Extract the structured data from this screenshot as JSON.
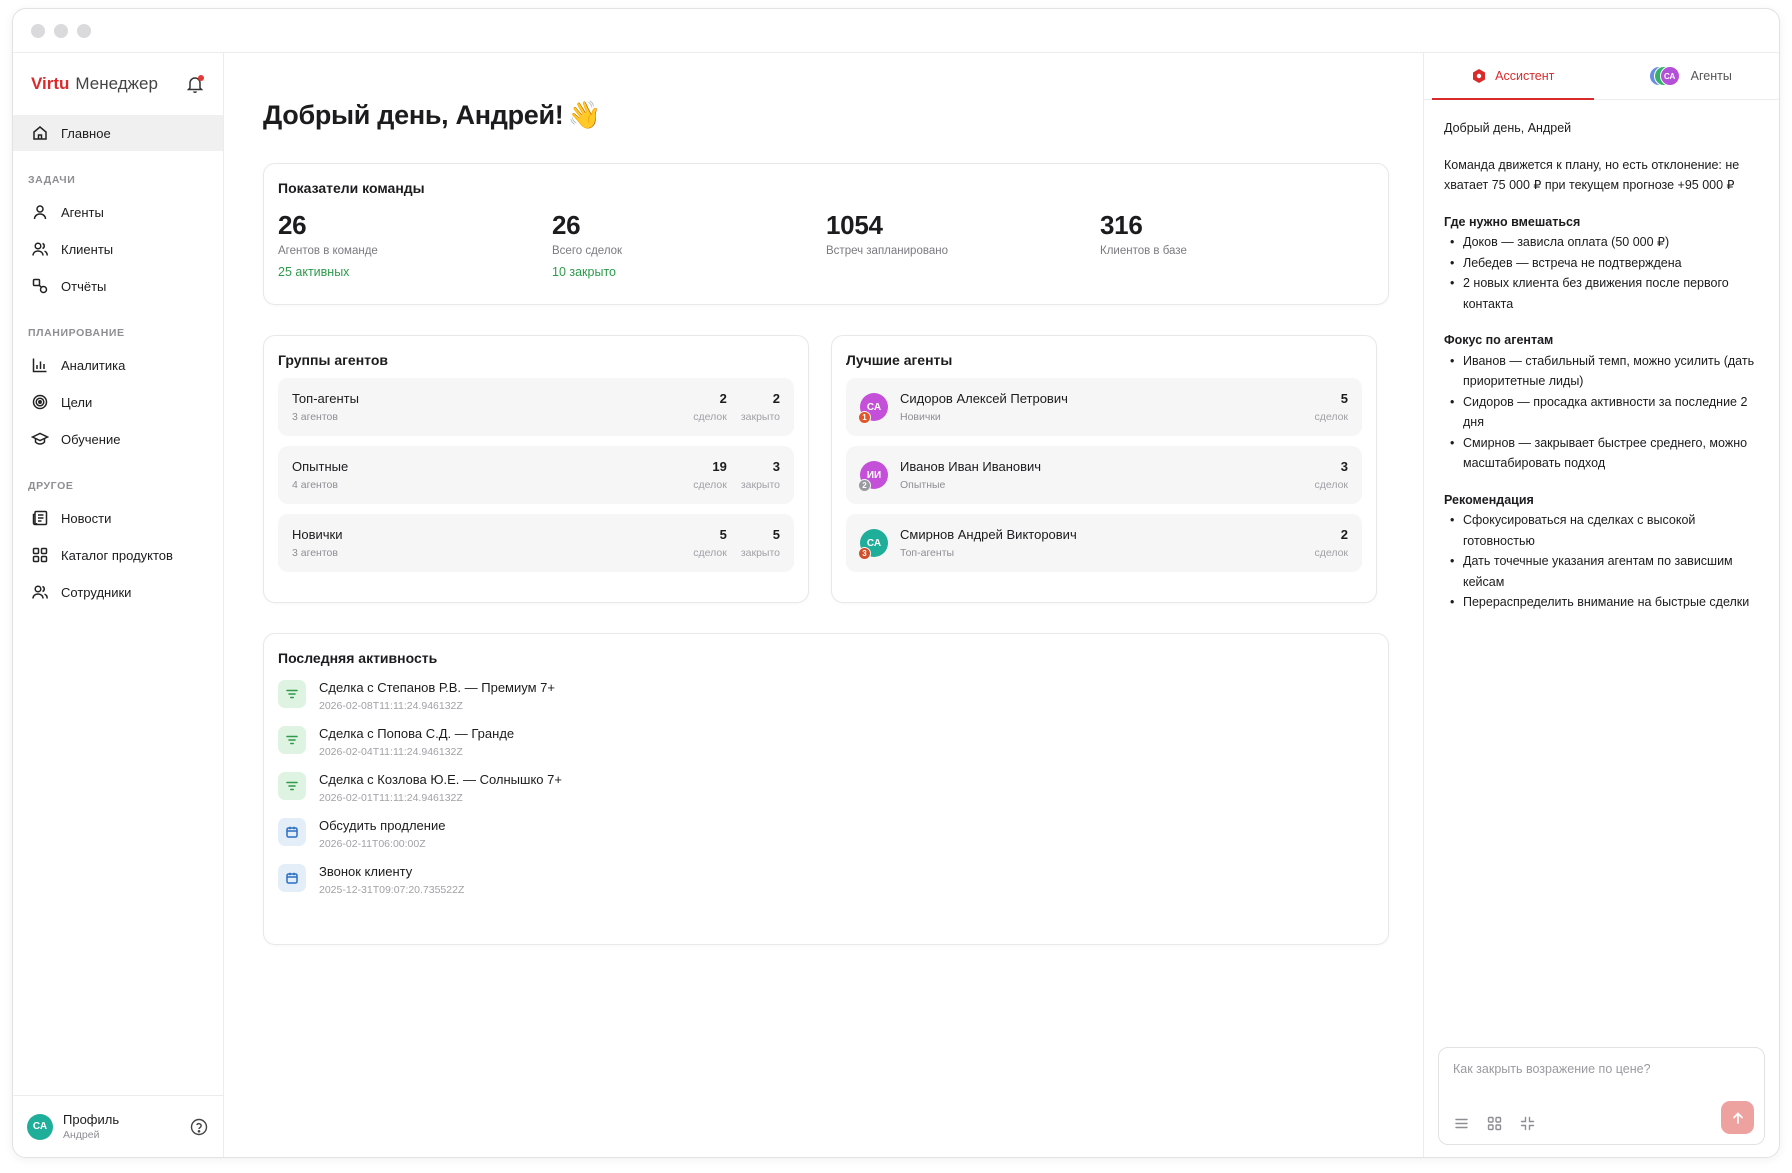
{
  "brand": {
    "virtu": "Virtu",
    "name": "Менеджер"
  },
  "nav": {
    "home": "Главное",
    "sections": {
      "tasks": "ЗАДАЧИ",
      "planning": "ПЛАНИРОВАНИЕ",
      "other": "ДРУГОЕ"
    },
    "items": {
      "agents": "Агенты",
      "clients": "Клиенты",
      "reports": "Отчёты",
      "analytics": "Аналитика",
      "goals": "Цели",
      "training": "Обучение",
      "news": "Новости",
      "catalog": "Каталог продуктов",
      "employees": "Сотрудники"
    }
  },
  "profile": {
    "initials": "СА",
    "name": "Профиль",
    "sub": "Андрей"
  },
  "greeting": "Добрый день, Андрей!",
  "greeting_emoji": "👋",
  "metrics": {
    "title": "Показатели команды",
    "items": [
      {
        "value": "26",
        "label": "Агентов в команде",
        "sub": "25 активных"
      },
      {
        "value": "26",
        "label": "Всего сделок",
        "sub": "10 закрыто"
      },
      {
        "value": "1054",
        "label": "Встреч запланировано",
        "sub": ""
      },
      {
        "value": "316",
        "label": "Клиентов в базе",
        "sub": ""
      }
    ]
  },
  "groups": {
    "title": "Группы агентов",
    "deals_label": "сделок",
    "closed_label": "закрыто",
    "items": [
      {
        "name": "Топ-агенты",
        "sub": "3 агентов",
        "deals": "2",
        "closed": "2"
      },
      {
        "name": "Опытные",
        "sub": "4 агентов",
        "deals": "19",
        "closed": "3"
      },
      {
        "name": "Новички",
        "sub": "3 агентов",
        "deals": "5",
        "closed": "5"
      }
    ]
  },
  "best_agents": {
    "title": "Лучшие агенты",
    "deals_label": "сделок",
    "items": [
      {
        "initials": "СА",
        "rank": "1",
        "name": "Сидоров Алексей Петрович",
        "group": "Новички",
        "deals": "5",
        "color": "#c44fd8",
        "rank_color": "#e0582a"
      },
      {
        "initials": "ИИ",
        "rank": "2",
        "name": "Иванов Иван Иванович",
        "group": "Опытные",
        "deals": "3",
        "color": "#c44fd8",
        "rank_color": "#9a9aa0"
      },
      {
        "initials": "СА",
        "rank": "3",
        "name": "Смирнов Андрей Викторович",
        "group": "Топ-агенты",
        "deals": "2",
        "color": "#1fae9a",
        "rank_color": "#d0502a"
      }
    ]
  },
  "activity": {
    "title": "Последняя активность",
    "items": [
      {
        "type": "deal",
        "icon": "filter-icon",
        "title": "Сделка с Степанов Р.В. — Премиум 7+",
        "date": "2026-02-08T11:11:24.946132Z"
      },
      {
        "type": "deal",
        "icon": "filter-icon",
        "title": "Сделка с Попова С.Д. — Гранде",
        "date": "2026-02-04T11:11:24.946132Z"
      },
      {
        "type": "deal",
        "icon": "filter-icon",
        "title": "Сделка с Козлова Ю.Е. — Солнышко 7+",
        "date": "2026-02-01T11:11:24.946132Z"
      },
      {
        "type": "task",
        "icon": "calendar-icon",
        "title": "Обсудить продление",
        "date": "2026-02-11T06:00:00Z"
      },
      {
        "type": "task",
        "icon": "calendar-icon",
        "title": "Звонок клиенту",
        "date": "2025-12-31T09:07:20.735522Z"
      }
    ]
  },
  "assistant": {
    "tab_assistant": "Ассистент",
    "tab_agents": "Агенты",
    "tab_agents_avatar": "СА",
    "greeting": "Добрый день, Андрей",
    "summary": "Команда движется к плану, но есть отклонение: не хватает 75 000 ₽ при текущем прогнозе +95 000 ₽",
    "sections": [
      {
        "title": "Где нужно вмешаться",
        "items": [
          "Доков — зависла оплата (50 000 ₽)",
          "Лебедев — встреча не подтверждена",
          "2 новых клиента без движения после первого контакта"
        ]
      },
      {
        "title": "Фокус по агентам",
        "items": [
          "Иванов — стабильный темп, можно усилить (дать приоритетные лиды)",
          "Сидоров — просадка активности за последние 2 дня",
          "Смирнов — закрывает быстрее среднего, можно масштабировать подход"
        ]
      },
      {
        "title": "Рекомендация",
        "items": [
          "Сфокусироваться на сделках с высокой готовностью",
          "Дать точечные указания агентам по зависшим кейсам",
          "Перераспределить внимание на быстрые сделки"
        ]
      }
    ],
    "input_placeholder": "Как закрыть возражение по цене?"
  },
  "colors": {
    "accent": "#d92b2b",
    "positive": "#2e9a4a",
    "send_button": "#eda2a0",
    "profile_avatar": "#1fae9a"
  }
}
